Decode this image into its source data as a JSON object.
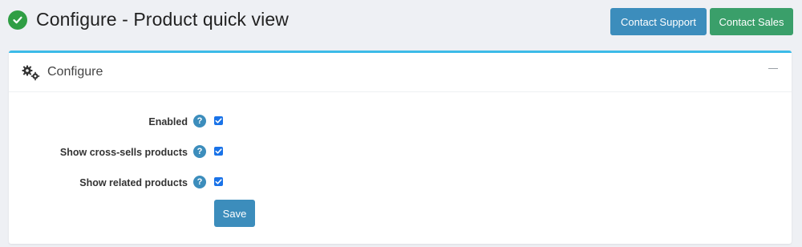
{
  "header": {
    "title": "Configure - Product quick view",
    "buttons": {
      "support": "Contact Support",
      "sales": "Contact Sales"
    }
  },
  "card": {
    "title": "Configure",
    "icon": "gears-icon",
    "collapse_icon": "minus-icon"
  },
  "form": {
    "fields": [
      {
        "label": "Enabled",
        "help": "?",
        "checked": true
      },
      {
        "label": "Show cross-sells products",
        "help": "?",
        "checked": true
      },
      {
        "label": "Show related products",
        "help": "?",
        "checked": true
      }
    ],
    "save_label": "Save"
  },
  "colors": {
    "primary": "#3c8dbc",
    "success": "#3a9f6a",
    "title_check": "#2f9e44",
    "card_accent": "#3cbbe8"
  }
}
